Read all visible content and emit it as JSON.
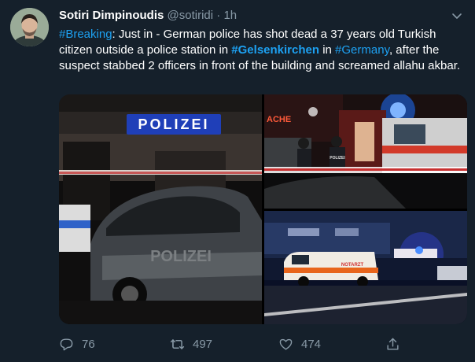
{
  "tweet": {
    "author_name": "Sotiri Dimpinoudis",
    "handle": "@sotiridi",
    "separator": "·",
    "time": "1h",
    "text_parts": [
      {
        "kind": "hashtag",
        "value": "#Breaking"
      },
      {
        "kind": "text",
        "value": ": Just in - German police has shot dead a 37 years old Turkish citizen outside a police station in "
      },
      {
        "kind": "hashtag-bold",
        "value": "#Gelsenkirchen"
      },
      {
        "kind": "text",
        "value": "  in "
      },
      {
        "kind": "hashtag",
        "value": "#Germany"
      },
      {
        "kind": "text",
        "value": ", after the suspect stabbed 2 officers in front of the building and screamed allahu akbar."
      }
    ],
    "media": {
      "photo1_sign": "POLIZEI",
      "photo1_car_text": "POLIZEI",
      "photo2_sign": "ACHE",
      "photo2_vest": "POLIZEI",
      "photo3_van_text": "NOTARZT"
    },
    "actions": {
      "replies": "76",
      "retweets": "497",
      "likes": "474"
    },
    "colors": {
      "background": "#15202b",
      "link": "#1da1f2",
      "muted": "#8899a6"
    },
    "icons": [
      "reply-icon",
      "retweet-icon",
      "like-icon",
      "share-icon",
      "caret-down-icon"
    ]
  }
}
